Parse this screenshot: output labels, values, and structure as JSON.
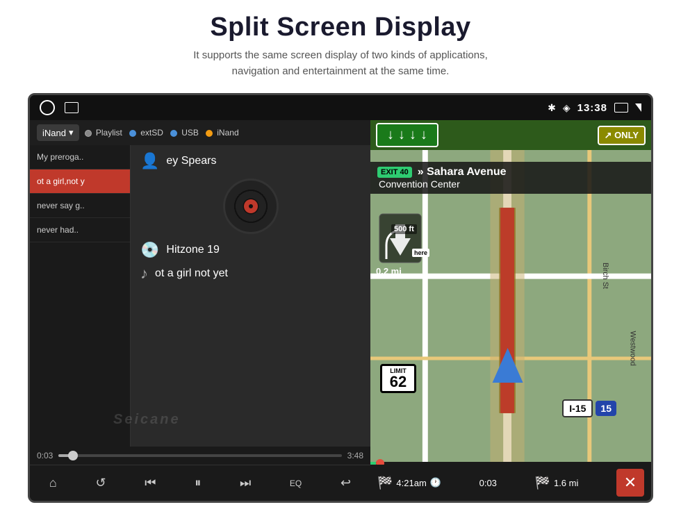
{
  "header": {
    "title": "Split Screen Display",
    "subtitle_line1": "It supports the same screen display of two kinds of applications,",
    "subtitle_line2": "navigation and entertainment at the same time."
  },
  "statusBar": {
    "time": "13:38",
    "bluetooth": "✱",
    "location": "◈"
  },
  "musicPanel": {
    "sourceDropdown": "iNand",
    "sources": [
      {
        "label": "Playlist",
        "color": "#888"
      },
      {
        "label": "extSD",
        "color": "#4a90d9"
      },
      {
        "label": "USB",
        "color": "#4a90d9"
      },
      {
        "label": "iNand",
        "color": "#f39c12"
      }
    ],
    "playlist": [
      {
        "text": "My preroga..",
        "active": false
      },
      {
        "text": "ot a girl,not y",
        "active": true
      },
      {
        "text": "never say g..",
        "active": false
      },
      {
        "text": "never had..",
        "active": false
      }
    ],
    "nowPlaying": {
      "artist": "ey Spears",
      "album": "Hitzone 19",
      "song": "ot a girl not yet"
    },
    "progress": {
      "current": "0:03",
      "total": "3:48"
    },
    "watermark": "Seicane",
    "controls": [
      {
        "icon": "⌂",
        "name": "home-button"
      },
      {
        "icon": "↺",
        "name": "repeat-button"
      },
      {
        "icon": "⏮",
        "name": "prev-button"
      },
      {
        "icon": "⏸",
        "name": "pause-button"
      },
      {
        "icon": "⏭",
        "name": "next-button"
      },
      {
        "icon": "EQ",
        "name": "eq-button"
      },
      {
        "icon": "↩",
        "name": "back-button"
      }
    ]
  },
  "navPanel": {
    "exitNumber": "EXIT 40",
    "exitDest": "» Sahara Avenue",
    "exitSubDest": "Convention Center",
    "speedLimit": "62",
    "highway": "I-15",
    "highwayNum": "15",
    "distanceFt": "500 ft",
    "distanceMi": "0.2 mi",
    "eta": {
      "arrivalTime": "4:21am",
      "elapsed": "0:03",
      "remaining": "1.6 mi"
    }
  }
}
